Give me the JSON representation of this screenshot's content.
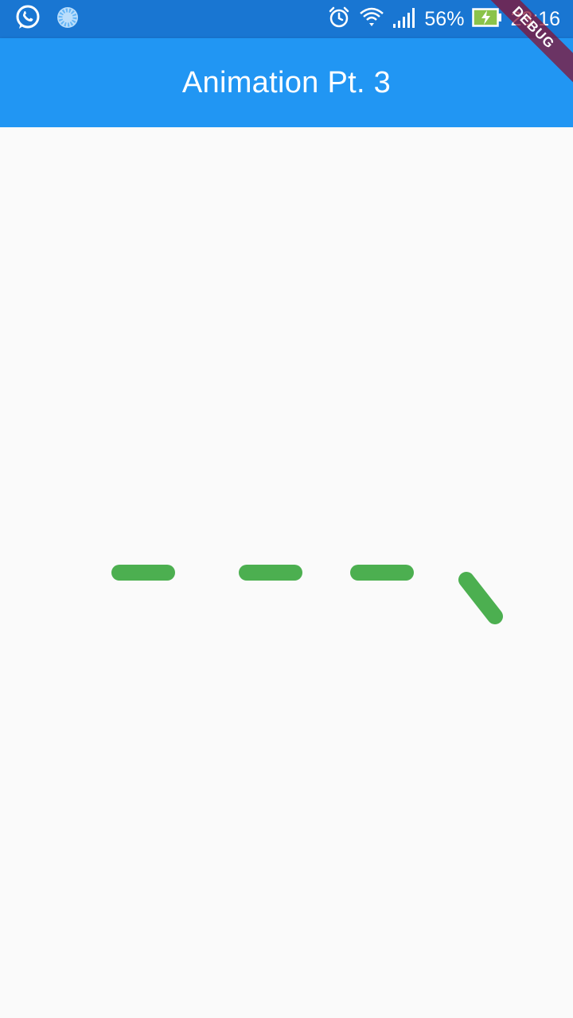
{
  "status_bar": {
    "battery_percent": "56%",
    "time": "23:16",
    "icons": [
      "whatsapp-icon",
      "loading-icon",
      "alarm-icon",
      "wifi-icon",
      "signal-icon",
      "battery-charging-icon"
    ],
    "background_color": "#1976d2"
  },
  "app_bar": {
    "title": "Animation Pt. 3",
    "background_color": "#2196f3"
  },
  "debug_banner": {
    "label": "DEBUG"
  },
  "animation": {
    "segment_color": "#4caf50",
    "segment_count": 4
  }
}
